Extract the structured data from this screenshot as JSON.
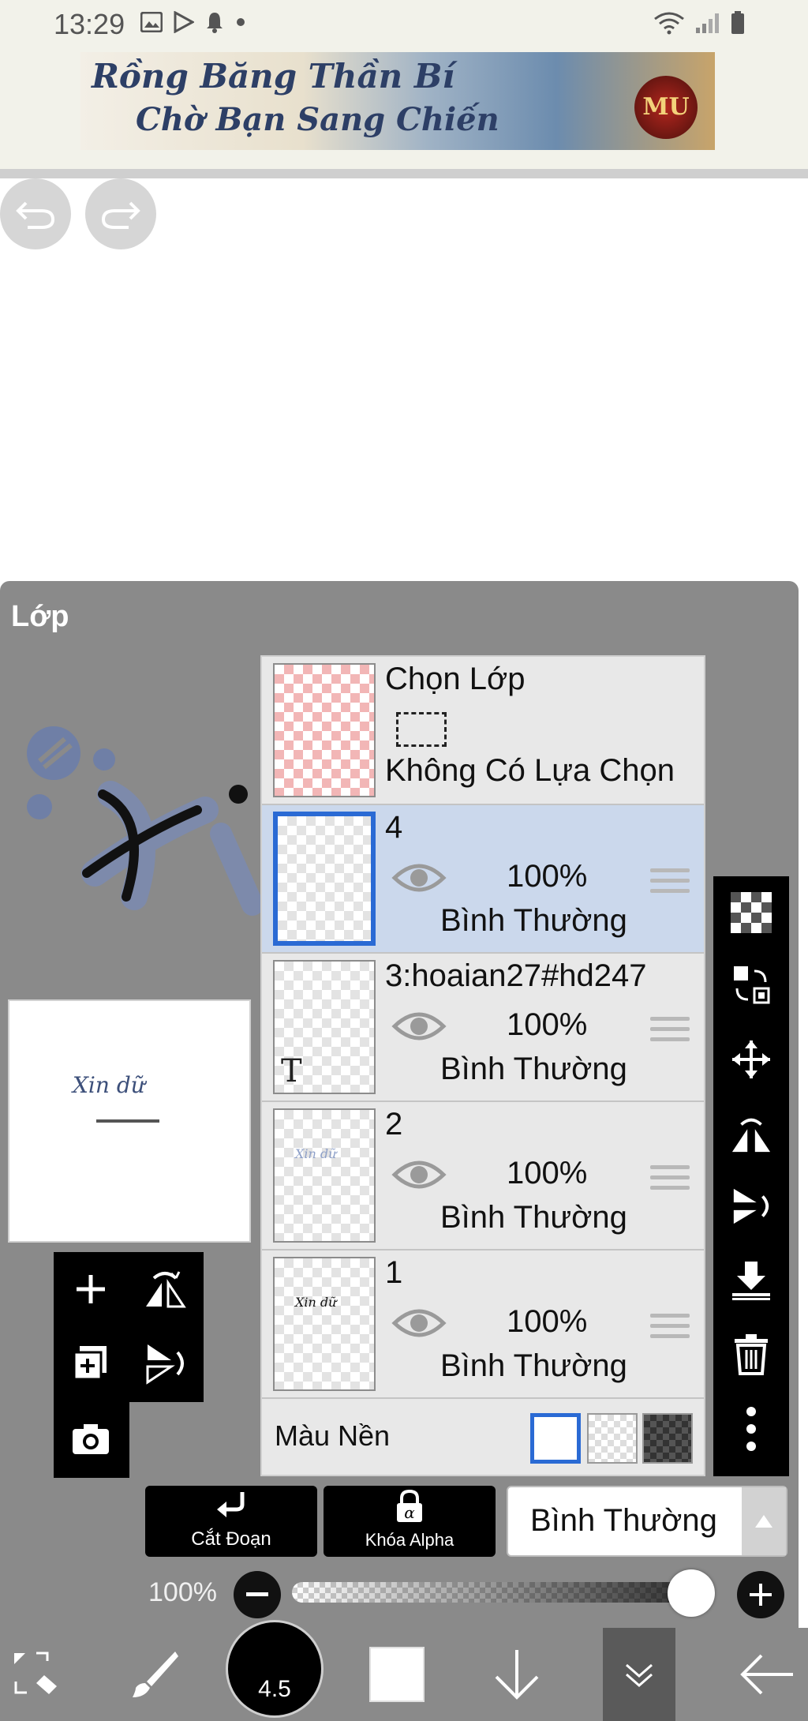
{
  "status_bar": {
    "time": "13:29"
  },
  "ad": {
    "line1": "Rồng Băng Thần Bí",
    "line2": "Chờ Bạn Sang Chiến",
    "logo": "MU"
  },
  "panel": {
    "title": "Lớp"
  },
  "canvas_preview": {
    "text": "Xin dữ",
    "text2": "Xin dữ"
  },
  "selection_layer": {
    "title": "Chọn Lớp",
    "status": "Không Có Lựa Chọn"
  },
  "layers": [
    {
      "name": "4",
      "opacity": "100%",
      "blend": "Bình Thường",
      "selected": true,
      "thumb_text": ""
    },
    {
      "name": "3:hoaian27#hd247",
      "opacity": "100%",
      "blend": "Bình Thường",
      "selected": false,
      "thumb_text": "T"
    },
    {
      "name": "2",
      "opacity": "100%",
      "blend": "Bình Thường",
      "selected": false,
      "thumb_text": "Xin dữ"
    },
    {
      "name": "1",
      "opacity": "100%",
      "blend": "Bình Thường",
      "selected": false,
      "thumb_text": "Xin dữ"
    }
  ],
  "background": {
    "label": "Màu Nền",
    "options": [
      "white",
      "transparent",
      "dark-checker"
    ],
    "selected": "white"
  },
  "actions": {
    "clip_label": "Cắt Đoạn",
    "alpha_lock_label": "Khóa Alpha",
    "blend_mode": "Bình Thường"
  },
  "opacity_control": {
    "label": "100%",
    "value": 1.0
  },
  "bottom_toolbar": {
    "brush_size": "4.5"
  },
  "colors": {
    "panel_bg": "#8a8a8a",
    "selected_row": "#cbd8ec",
    "accent_blue": "#2a6ad4",
    "toolbar_black": "#000000"
  }
}
